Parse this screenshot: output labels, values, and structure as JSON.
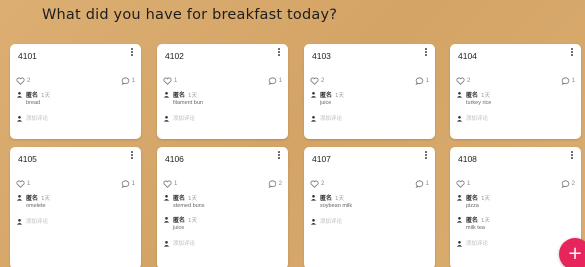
{
  "board": {
    "title": "What did you have for breakfast today?"
  },
  "icons": {
    "like": "heart-icon",
    "comment": "comment-bubble-icon",
    "menu": "kebab-menu-icon",
    "avatar": "avatar-icon",
    "add": "plus-icon"
  },
  "colors": {
    "background": "#d9ab6e",
    "card": "#ffffff",
    "fab": "#e8245c"
  },
  "cards": [
    {
      "title": "4101",
      "likes": "2",
      "comments_count": "1",
      "comments": [
        {
          "name": "匿名",
          "time": "1天",
          "text": "bread"
        }
      ],
      "add_comment": "添加评论"
    },
    {
      "title": "4102",
      "likes": "1",
      "comments_count": "1",
      "comments": [
        {
          "name": "匿名",
          "time": "1天",
          "text": "filament bun"
        }
      ],
      "add_comment": "添加评论"
    },
    {
      "title": "4103",
      "likes": "2",
      "comments_count": "1",
      "comments": [
        {
          "name": "匿名",
          "time": "1天",
          "text": "juice"
        }
      ],
      "add_comment": "添加评论"
    },
    {
      "title": "4104",
      "likes": "2",
      "comments_count": "1",
      "comments": [
        {
          "name": "匿名",
          "time": "1天",
          "text": "turkey rice"
        }
      ],
      "add_comment": "添加评论"
    },
    {
      "title": "4105",
      "likes": "1",
      "comments_count": "1",
      "comments": [
        {
          "name": "匿名",
          "time": "1天",
          "text": "omelete"
        }
      ],
      "add_comment": "添加评论"
    },
    {
      "title": "4106",
      "likes": "1",
      "comments_count": "2",
      "comments": [
        {
          "name": "匿名",
          "time": "1天",
          "text": "stemed buns"
        },
        {
          "name": "匿名",
          "time": "1天",
          "text": "juice"
        }
      ],
      "add_comment": "添加评论"
    },
    {
      "title": "4107",
      "likes": "2",
      "comments_count": "1",
      "comments": [
        {
          "name": "匿名",
          "time": "1天",
          "text": "soybean milk"
        }
      ],
      "add_comment": "添加评论"
    },
    {
      "title": "4108",
      "likes": "1",
      "comments_count": "2",
      "comments": [
        {
          "name": "匿名",
          "time": "1天",
          "text": "pizza"
        },
        {
          "name": "匿名",
          "time": "1天",
          "text": "milk tea"
        }
      ],
      "add_comment": "添加评论"
    }
  ],
  "fab": {
    "label": "+"
  }
}
